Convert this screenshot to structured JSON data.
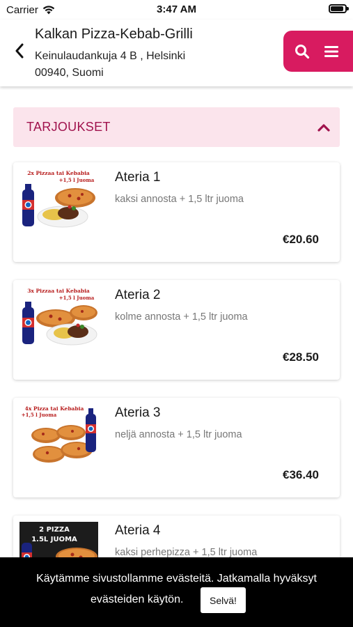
{
  "status_bar": {
    "carrier": "Carrier",
    "time": "3:47 AM",
    "battery_level": 0.9
  },
  "header": {
    "restaurant_name": "Kalkan Pizza-Kebab-Grilli",
    "address_line1": "Keinulaudankuja 4 B , Helsinki",
    "address_line2": "00940, Suomi"
  },
  "category": {
    "title": "TARJOUKSET"
  },
  "items": [
    {
      "title": "Ateria 1",
      "description": "kaksi annosta + 1,5 ltr juoma",
      "price": "€20.60",
      "image_caption": [
        "2x Pizzaa tai Kebabia",
        "+1,5 l Juoma"
      ]
    },
    {
      "title": "Ateria 2",
      "description": "kolme annosta + 1,5 ltr juoma",
      "price": "€28.50",
      "image_caption": [
        "3x Pizzaa tai Kebabia",
        "+1,5 l Juoma"
      ]
    },
    {
      "title": "Ateria 3",
      "description": "neljä annosta + 1,5 ltr juoma",
      "price": "€36.40",
      "image_caption": [
        "4x Pizza tai Kebabia",
        "+1,5 l Juoma"
      ]
    },
    {
      "title": "Ateria 4",
      "description": "kaksi perhepizza + 1,5 ltr juoma",
      "price": "",
      "image_caption": [
        "2 PIZZA",
        "1.5L JUOMA"
      ]
    }
  ],
  "cookie_banner": {
    "line1": "Käytämme sivustollamme evästeitä. Jatkamalla hyväksyt",
    "line2": "evästeiden käytön.",
    "accept_label": "Selvä!"
  },
  "colors": {
    "accent": "#d81b60",
    "category_bg": "#fbe4ec",
    "category_text": "#a0124d"
  }
}
